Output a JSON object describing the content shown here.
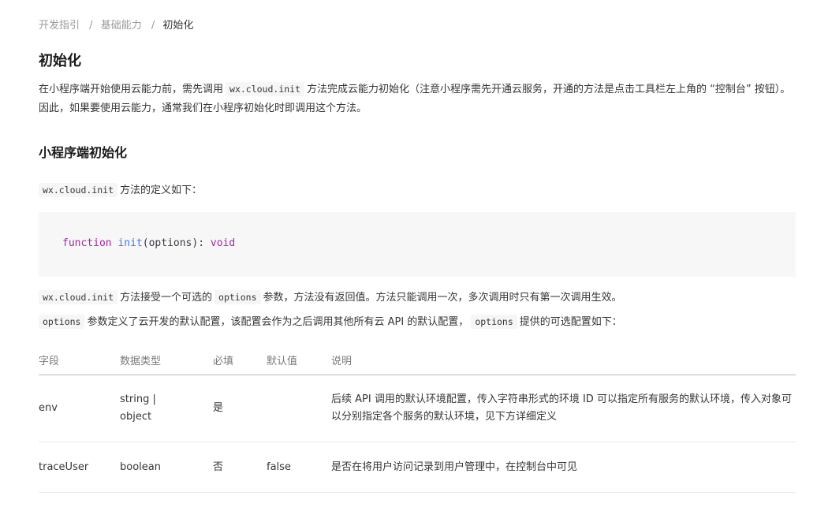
{
  "breadcrumb": {
    "items": [
      "开发指引",
      "基础能力"
    ],
    "separator": "/",
    "current": "初始化"
  },
  "title": "初始化",
  "intro": {
    "before": "在小程序端开始使用云能力前，需先调用",
    "code": "wx.cloud.init",
    "after": "方法完成云能力初始化（注意小程序需先开通云服务，开通的方法是点击工具栏左上角的 “控制台” 按钮）。因此，如果要使用云能力，通常我们在小程序初始化时即调用这个方法。"
  },
  "section_title": "小程序端初始化",
  "definition_line": {
    "code": "wx.cloud.init",
    "text": "方法的定义如下："
  },
  "code_block": {
    "keyword": "function",
    "name": "init",
    "params": "(options)",
    "colon": ":",
    "return_type": "void"
  },
  "paragraph1": {
    "code1": "wx.cloud.init",
    "text1": "方法接受一个可选的",
    "code2": "options",
    "text2": "参数，方法没有返回值。方法只能调用一次，多次调用时只有第一次调用生效。"
  },
  "paragraph2": {
    "code1": "options",
    "text1": "参数定义了云开发的默认配置，该配置会作为之后调用其他所有云 API 的默认配置，",
    "code2": "options",
    "text2": "提供的可选配置如下："
  },
  "table": {
    "headers": [
      "字段",
      "数据类型",
      "必填",
      "默认值",
      "说明"
    ],
    "rows": [
      [
        "env",
        "string | object",
        "是",
        "",
        "后续 API 调用的默认环境配置，传入字符串形式的环境 ID 可以指定所有服务的默认环境，传入对象可以分别指定各个服务的默认环境，见下方详细定义"
      ],
      [
        "traceUser",
        "boolean",
        "否",
        "false",
        "是否在将用户访问记录到用户管理中，在控制台中可见"
      ]
    ]
  },
  "colors": {
    "text": "#353535",
    "muted": "#9a9a9a",
    "code_bg": "#f7f7f7",
    "keyword": "#a626a4",
    "function_name": "#4078f2"
  }
}
